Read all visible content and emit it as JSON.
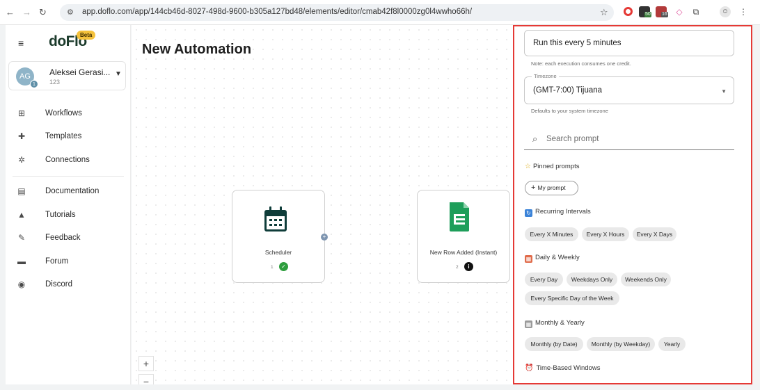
{
  "browser": {
    "url": "app.doflo.com/app/144cb46d-8027-498d-9600-b305a127bd48/elements/editor/cmab42f8l0000zg0l4wwho66h/",
    "ext_badge_1": "50",
    "ext_badge_2": "16"
  },
  "sidebar": {
    "logo": "doFlo",
    "beta_label": "Beta",
    "user": {
      "initials": "AG",
      "badge": "1",
      "name": "Aleksei Gerasi...",
      "sub": "123"
    },
    "items": [
      {
        "label": "Workflows",
        "icon": "workflow-icon"
      },
      {
        "label": "Templates",
        "icon": "puzzle-icon"
      },
      {
        "label": "Connections",
        "icon": "connections-icon"
      },
      {
        "label": "Documentation",
        "icon": "book-icon"
      },
      {
        "label": "Tutorials",
        "icon": "graduation-cap-icon"
      },
      {
        "label": "Feedback",
        "icon": "feedback-icon"
      },
      {
        "label": "Forum",
        "icon": "forum-icon"
      },
      {
        "label": "Discord",
        "icon": "discord-icon"
      }
    ]
  },
  "canvas": {
    "title": "New Automation",
    "nodes": [
      {
        "label": "Scheduler",
        "count": "1",
        "status": "success"
      },
      {
        "label": "New Row Added (Instant)",
        "count": "2",
        "status": "info"
      }
    ],
    "zoom_in": "+",
    "zoom_out": "−"
  },
  "panel": {
    "prompt_value": "Run this every 5 minutes",
    "prompt_note": "Note: each execution consumes one credit.",
    "timezone_legend": "Timezone",
    "timezone_value": "(GMT-7:00) Tijuana",
    "timezone_helper": "Defaults to your system timezone",
    "search_placeholder": "Search prompt",
    "pinned_title": "Pinned prompts",
    "my_prompt_label": "My prompt",
    "sections": {
      "recurring": {
        "title": "Recurring Intervals",
        "chips": [
          "Every X Minutes",
          "Every X Hours",
          "Every X Days"
        ]
      },
      "daily": {
        "title": "Daily & Weekly",
        "chips": [
          "Every Day",
          "Weekdays Only",
          "Weekends Only",
          "Every Specific Day of the Week"
        ]
      },
      "monthly": {
        "title": "Monthly & Yearly",
        "chips": [
          "Monthly (by Date)",
          "Monthly (by Weekday)",
          "Yearly"
        ]
      },
      "time": {
        "title": "Time-Based Windows"
      }
    },
    "colors": {
      "highlight_border": "#e53935",
      "brand_dark": "#1c3b2c",
      "sheets_green": "#1e9e5a",
      "success_green": "#2e9e3e"
    }
  }
}
